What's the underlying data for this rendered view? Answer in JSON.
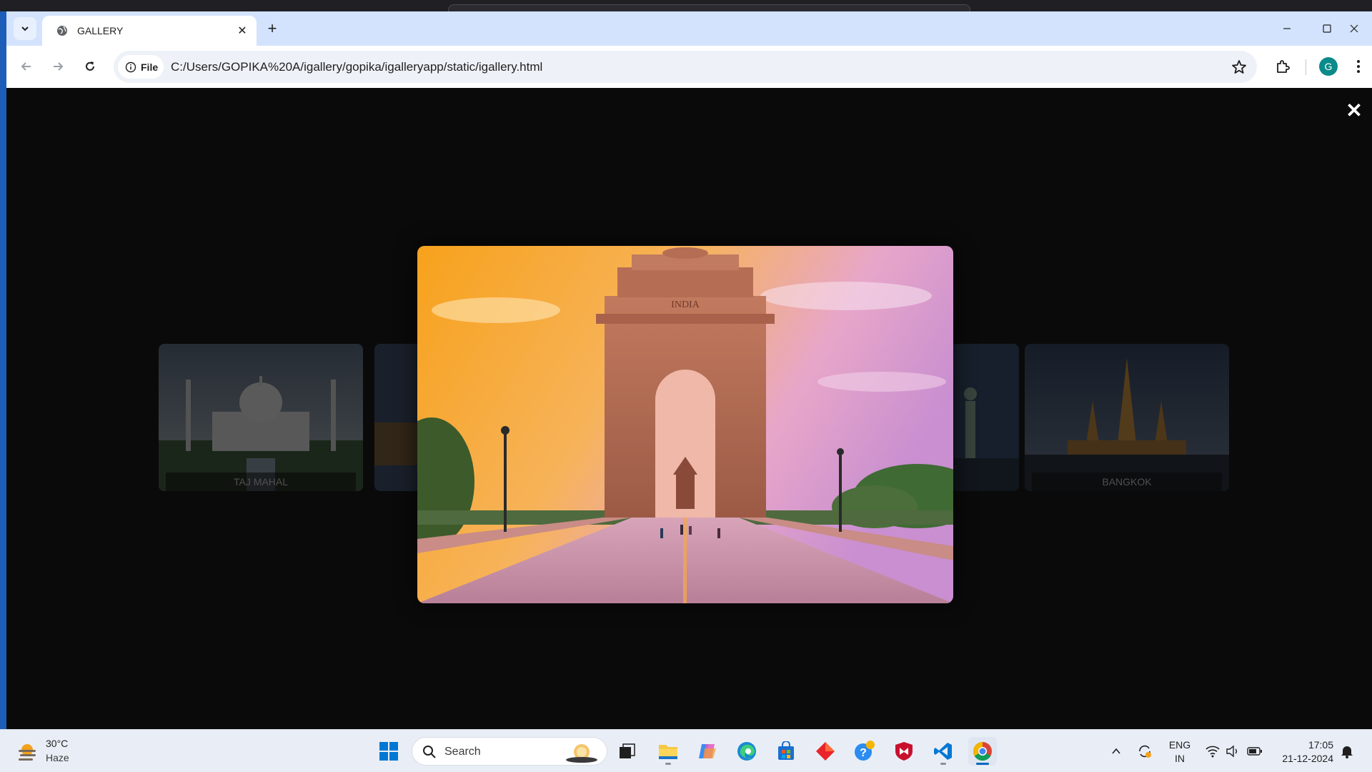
{
  "browser": {
    "tab_title": "GALLERY",
    "url_chip": "File",
    "url": "C:/Users/GOPIKA%20A/igallery/gopika/igalleryapp/static/igallery.html",
    "profile_initial": "G"
  },
  "gallery": {
    "close_symbol": "✕",
    "cards": [
      {
        "caption": "TAJ MAHAL"
      },
      {
        "caption": "BANGKOK"
      }
    ],
    "modal_image_text": "INDIA"
  },
  "taskbar": {
    "weather_temp": "30°C",
    "weather_desc": "Haze",
    "search_placeholder": "Search",
    "lang_line1": "ENG",
    "lang_line2": "IN",
    "time": "17:05",
    "date": "21-12-2024"
  },
  "colors": {
    "tabstrip": "#d3e3fd",
    "page_bg": "#0a0a0a",
    "taskbar": "#e9eef6",
    "accent": "#0067c0"
  }
}
